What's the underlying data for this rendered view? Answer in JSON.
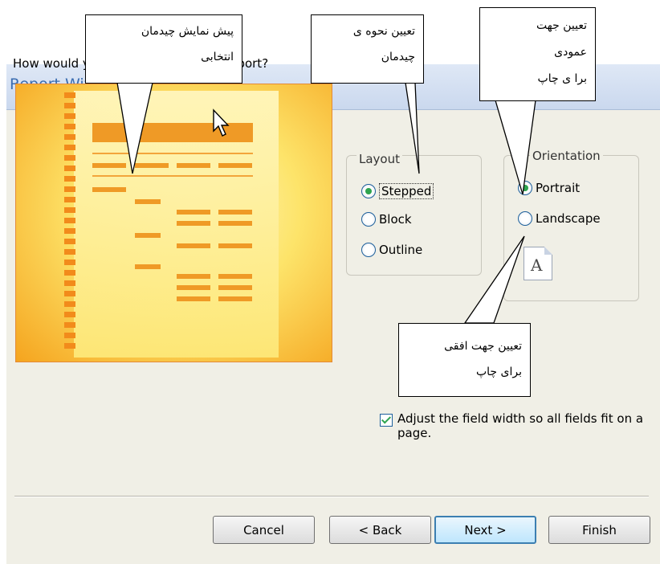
{
  "window": {
    "title": "Report Wiza"
  },
  "question": "How would you like to lay out your report?",
  "layout_group": {
    "legend": "Layout",
    "options": [
      {
        "label": "Stepped",
        "selected": true
      },
      {
        "label": "Block",
        "selected": false
      },
      {
        "label": "Outline",
        "selected": false
      }
    ]
  },
  "orientation_group": {
    "legend": "Orientation",
    "options": [
      {
        "label": "Portrait",
        "selected": true
      },
      {
        "label": "Landscape",
        "selected": false
      }
    ],
    "icon": "portrait-page-icon",
    "icon_glyph": "A"
  },
  "adjust_width": {
    "checked": true,
    "label": "Adjust the field width so all fields fit on a page."
  },
  "buttons": {
    "cancel": "Cancel",
    "back": "< Back",
    "next": "Next >",
    "finish": "Finish"
  },
  "callouts": {
    "preview": [
      "پیش نمایش چیدمان",
      "انتخابی"
    ],
    "layout": [
      "تعیین نحوه ی",
      "چیدمان"
    ],
    "vertical": [
      "تعیین جهت",
      "عمودی",
      "برا ی چاپ"
    ],
    "horizontal": [
      "تعیین جهت افقی",
      "برای چاپ"
    ]
  },
  "colors": {
    "title_text": "#3b6db0",
    "preview_orange": "#f5a41e",
    "preview_yellow": "#fde46a",
    "selected_radio": "#2ea44f",
    "dialog_bg": "#f0efe6"
  }
}
